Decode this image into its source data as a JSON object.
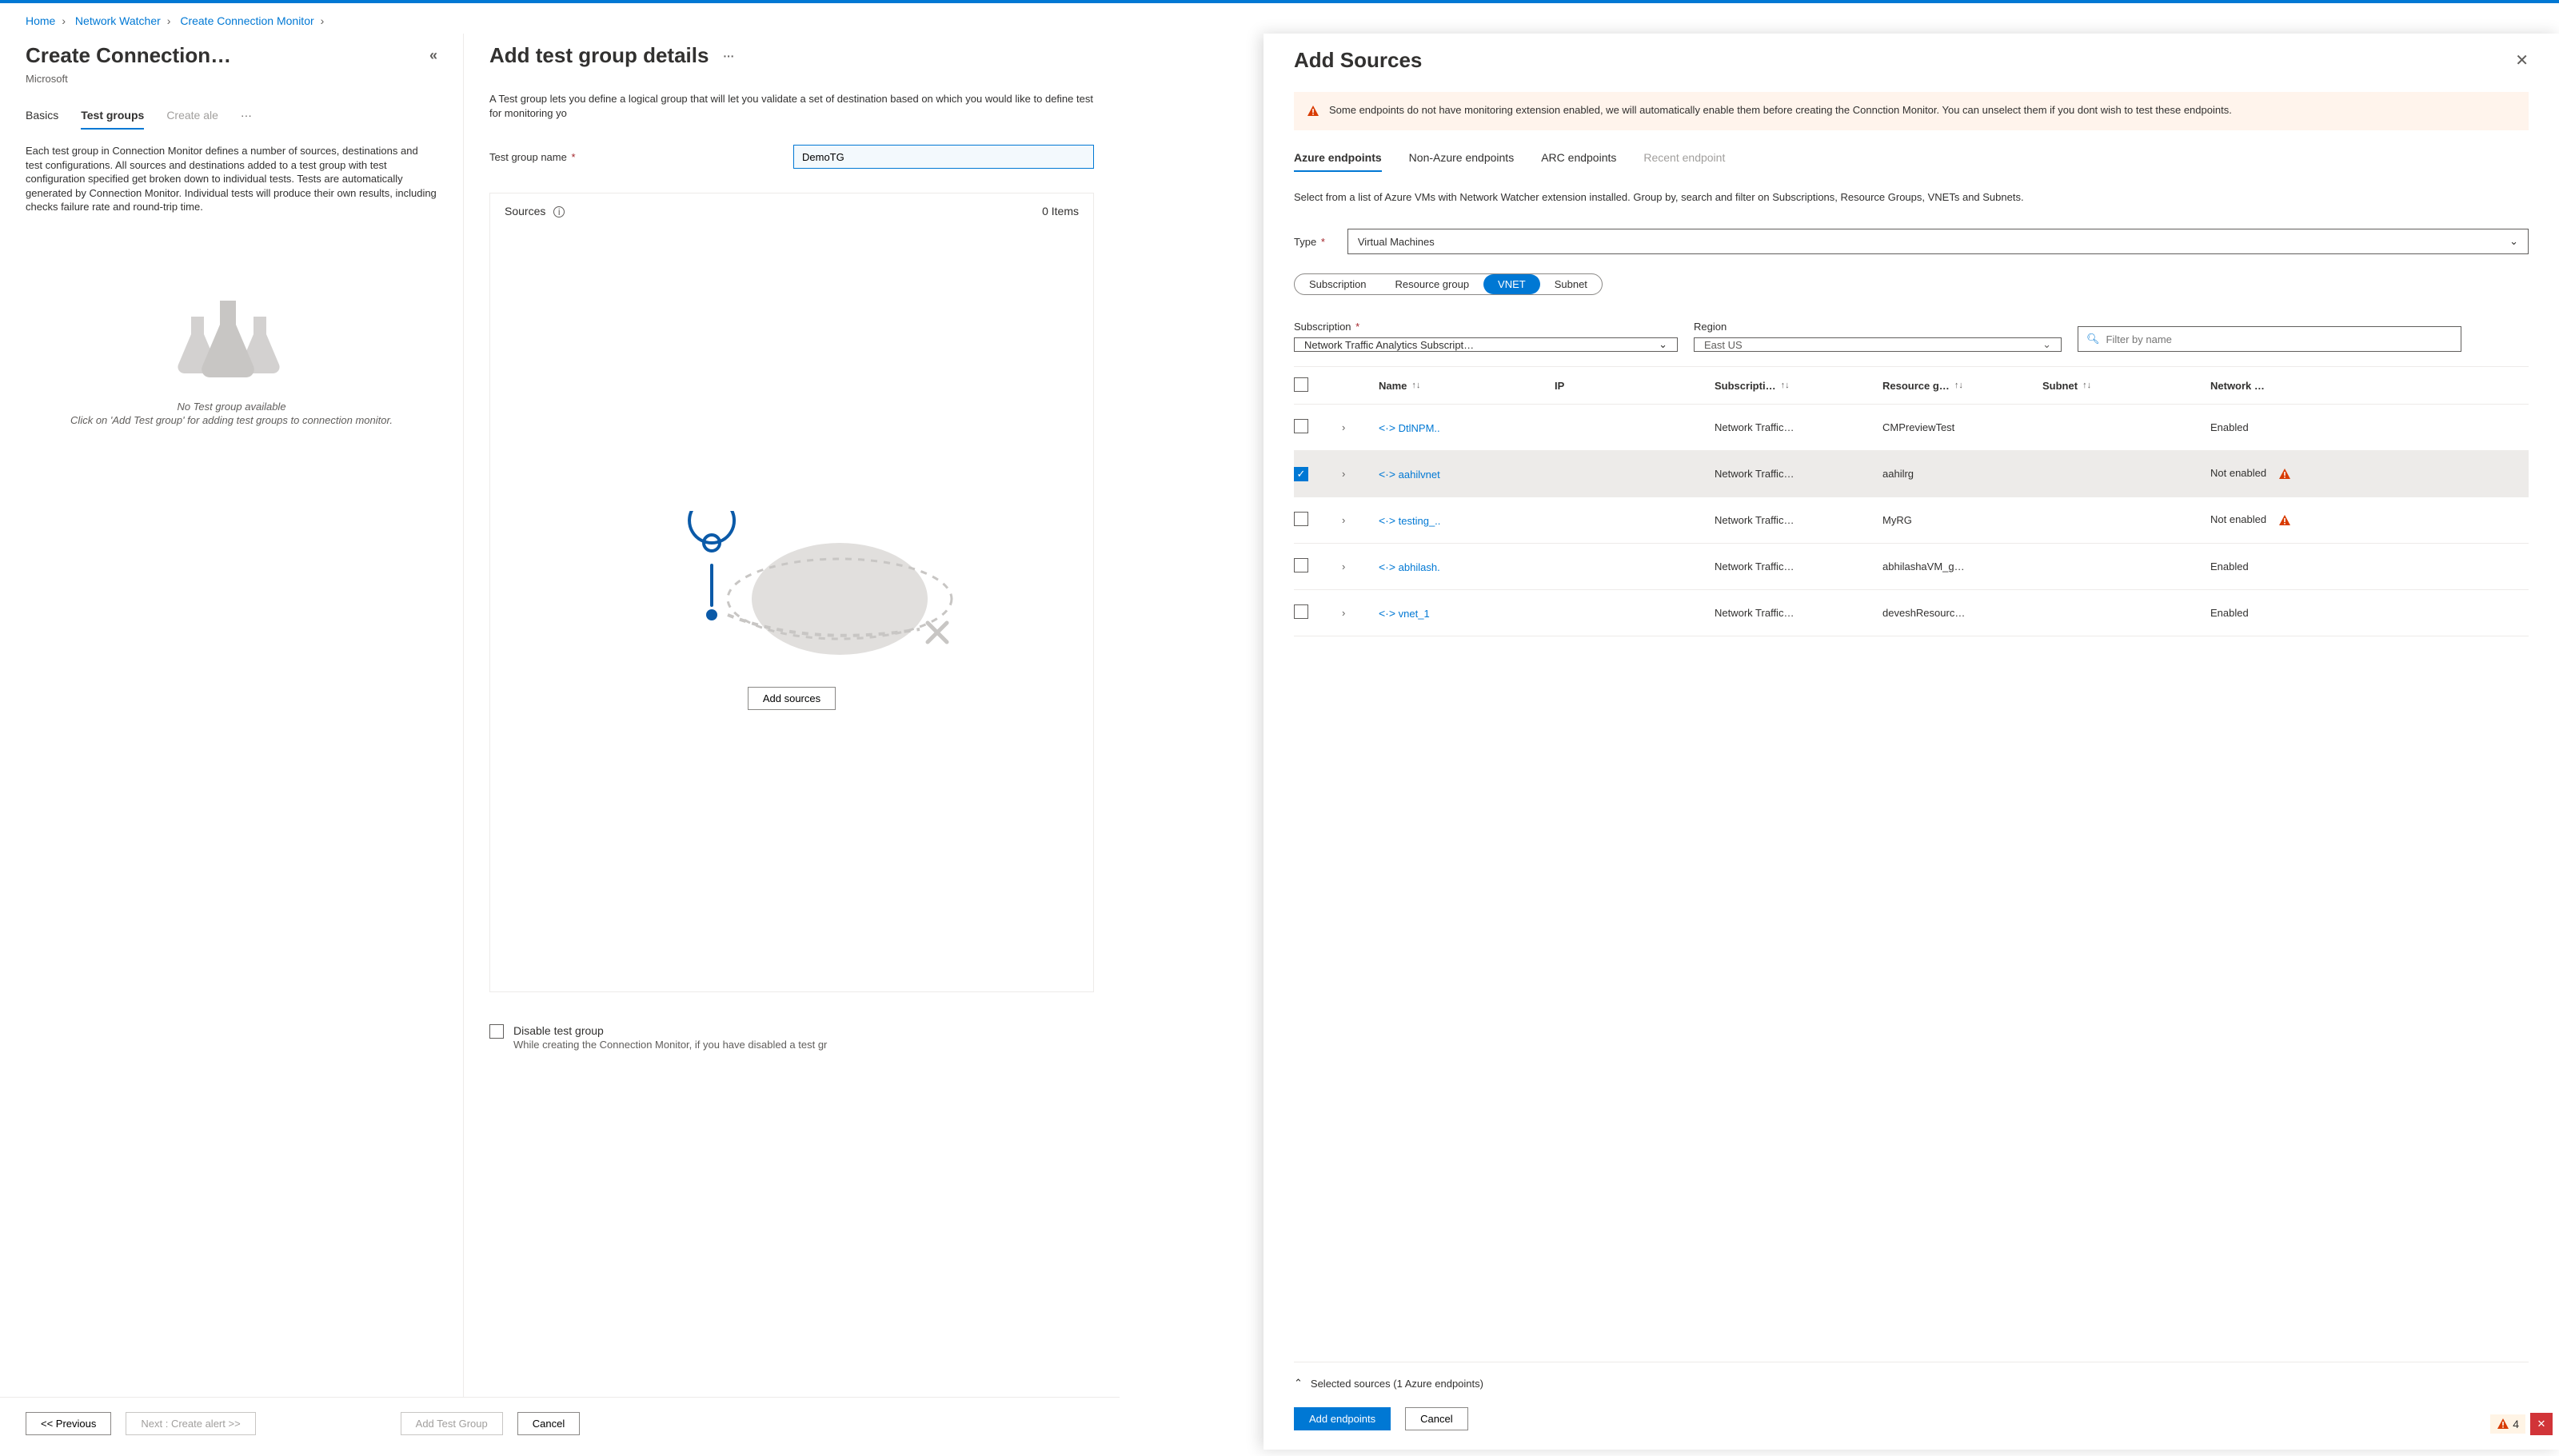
{
  "breadcrumb": [
    "Home",
    "Network Watcher",
    "Create Connection Monitor"
  ],
  "left": {
    "title": "Create Connection…",
    "subtitle": "Microsoft",
    "tabs": [
      "Basics",
      "Test groups",
      "Create ale",
      "···"
    ],
    "activeTab": 1,
    "desc": "Each test group in Connection Monitor defines a number of sources, destinations and test configurations. All sources and destinations added to a test group with test configuration specified get broken down to individual tests. Tests are automatically generated by Connection Monitor. Individual tests will produce their own results, including checks failure rate and round-trip time.",
    "empty1": "No Test group available",
    "empty2": "Click on 'Add Test group' for adding test groups to connection monitor."
  },
  "mid": {
    "title": "Add test group details",
    "desc": "A Test group lets you define a logical group that will let you validate a set of destination based on which you would like to define test for monitoring yo",
    "tg_label": "Test group name",
    "tg_value": "DemoTG",
    "sources_label": "Sources",
    "items_count": "0 Items",
    "add_sources": "Add sources",
    "disable_label": "Disable test group",
    "disable_sub": "While creating the Connection Monitor, if you have disabled a test gr"
  },
  "bottom": {
    "prev": "<< Previous",
    "next": "Next : Create alert >>",
    "add_tg": "Add Test Group",
    "cancel": "Cancel"
  },
  "panel": {
    "title": "Add Sources",
    "banner": "Some endpoints do not have monitoring extension enabled, we will automatically enable them before creating the Connction Monitor. You can unselect them if you dont wish to test these endpoints.",
    "tabs": [
      "Azure endpoints",
      "Non-Azure endpoints",
      "ARC endpoints",
      "Recent endpoint"
    ],
    "activeTab": 0,
    "desc": "Select from a list of Azure VMs with Network Watcher extension installed. Group by, search and filter on Subscriptions, Resource Groups, VNETs and Subnets.",
    "type_label": "Type",
    "type_value": "Virtual Machines",
    "pills": [
      "Subscription",
      "Resource group",
      "VNET",
      "Subnet"
    ],
    "activePill": 2,
    "sub_label": "Subscription",
    "sub_value": "Network Traffic Analytics Subscript…",
    "region_label": "Region",
    "region_value": "East US",
    "filter_placeholder": "Filter by name",
    "cols": [
      "Name",
      "IP",
      "Subscripti…",
      "Resource g…",
      "Subnet",
      "Network …"
    ],
    "rows": [
      {
        "name": "DtlNPM..",
        "sub": "Network Traffic…",
        "rg": "CMPreviewTest",
        "net": "Enabled",
        "warn": false,
        "checked": false
      },
      {
        "name": "aahilvnet",
        "sub": "Network Traffic…",
        "rg": "aahilrg",
        "net": "Not enabled",
        "warn": true,
        "checked": true
      },
      {
        "name": "testing_..",
        "sub": "Network Traffic…",
        "rg": "MyRG",
        "net": "Not enabled",
        "warn": true,
        "checked": false
      },
      {
        "name": "abhilash.",
        "sub": "Network Traffic…",
        "rg": "abhilashaVM_g…",
        "net": "Enabled",
        "warn": false,
        "checked": false
      },
      {
        "name": "vnet_1",
        "sub": "Network Traffic…",
        "rg": "deveshResourc…",
        "net": "Enabled",
        "warn": false,
        "checked": false
      }
    ],
    "selected_summary": "Selected sources (1 Azure endpoints)",
    "add_btn": "Add endpoints",
    "cancel_btn": "Cancel",
    "warn_count": "4"
  }
}
